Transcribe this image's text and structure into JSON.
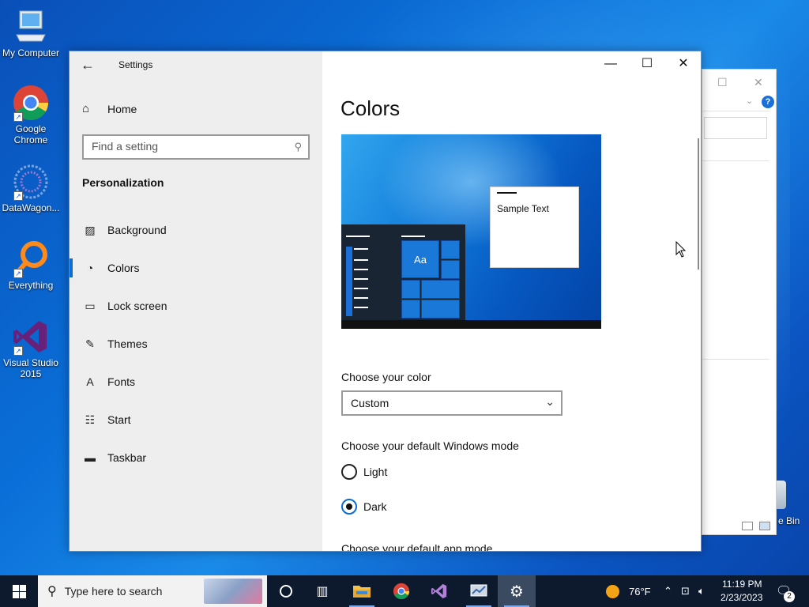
{
  "desktop": {
    "icons": [
      {
        "label": "My Computer",
        "icon": "computer-icon"
      },
      {
        "label": "Google Chrome",
        "icon": "chrome-icon"
      },
      {
        "label": "DataWagon...",
        "icon": "datawagon-icon"
      },
      {
        "label": "Everything",
        "icon": "everything-icon"
      },
      {
        "label": "Visual Studio 2015",
        "icon": "visual-studio-icon"
      }
    ],
    "recycle_bin_label": "e Bin"
  },
  "settings_window": {
    "title": "Settings",
    "back_icon": "←",
    "minimize_icon": "—",
    "maximize_icon": "☐",
    "close_icon": "✕",
    "sidebar": {
      "home_label": "Home",
      "search_placeholder": "Find a setting",
      "section_title": "Personalization",
      "items": [
        {
          "label": "Background",
          "icon": "image-icon",
          "glyph": "▨",
          "active": false
        },
        {
          "label": "Colors",
          "icon": "palette-icon",
          "glyph": "◔",
          "active": true
        },
        {
          "label": "Lock screen",
          "icon": "lock-screen-icon",
          "glyph": "▭",
          "active": false
        },
        {
          "label": "Themes",
          "icon": "themes-icon",
          "glyph": "✎",
          "active": false
        },
        {
          "label": "Fonts",
          "icon": "fonts-icon",
          "glyph": "A",
          "active": false
        },
        {
          "label": "Start",
          "icon": "start-icon",
          "glyph": "☷",
          "active": false
        },
        {
          "label": "Taskbar",
          "icon": "taskbar-icon",
          "glyph": "▬",
          "active": false
        }
      ]
    },
    "main": {
      "page_title": "Colors",
      "preview_sample_text": "Sample Text",
      "preview_tile_text": "Aa",
      "choose_color_label": "Choose your color",
      "choose_color_value": "Custom",
      "windows_mode_label": "Choose your default Windows mode",
      "windows_mode_options": [
        {
          "label": "Light",
          "selected": false
        },
        {
          "label": "Dark",
          "selected": true
        }
      ],
      "app_mode_label": "Choose your default app mode"
    }
  },
  "taskbar": {
    "search_placeholder": "Type here to search",
    "weather_temp": "76°F",
    "time": "11:19 PM",
    "date": "2/23/2023",
    "notification_count": "2",
    "accent_color": "#0a6dd4"
  }
}
